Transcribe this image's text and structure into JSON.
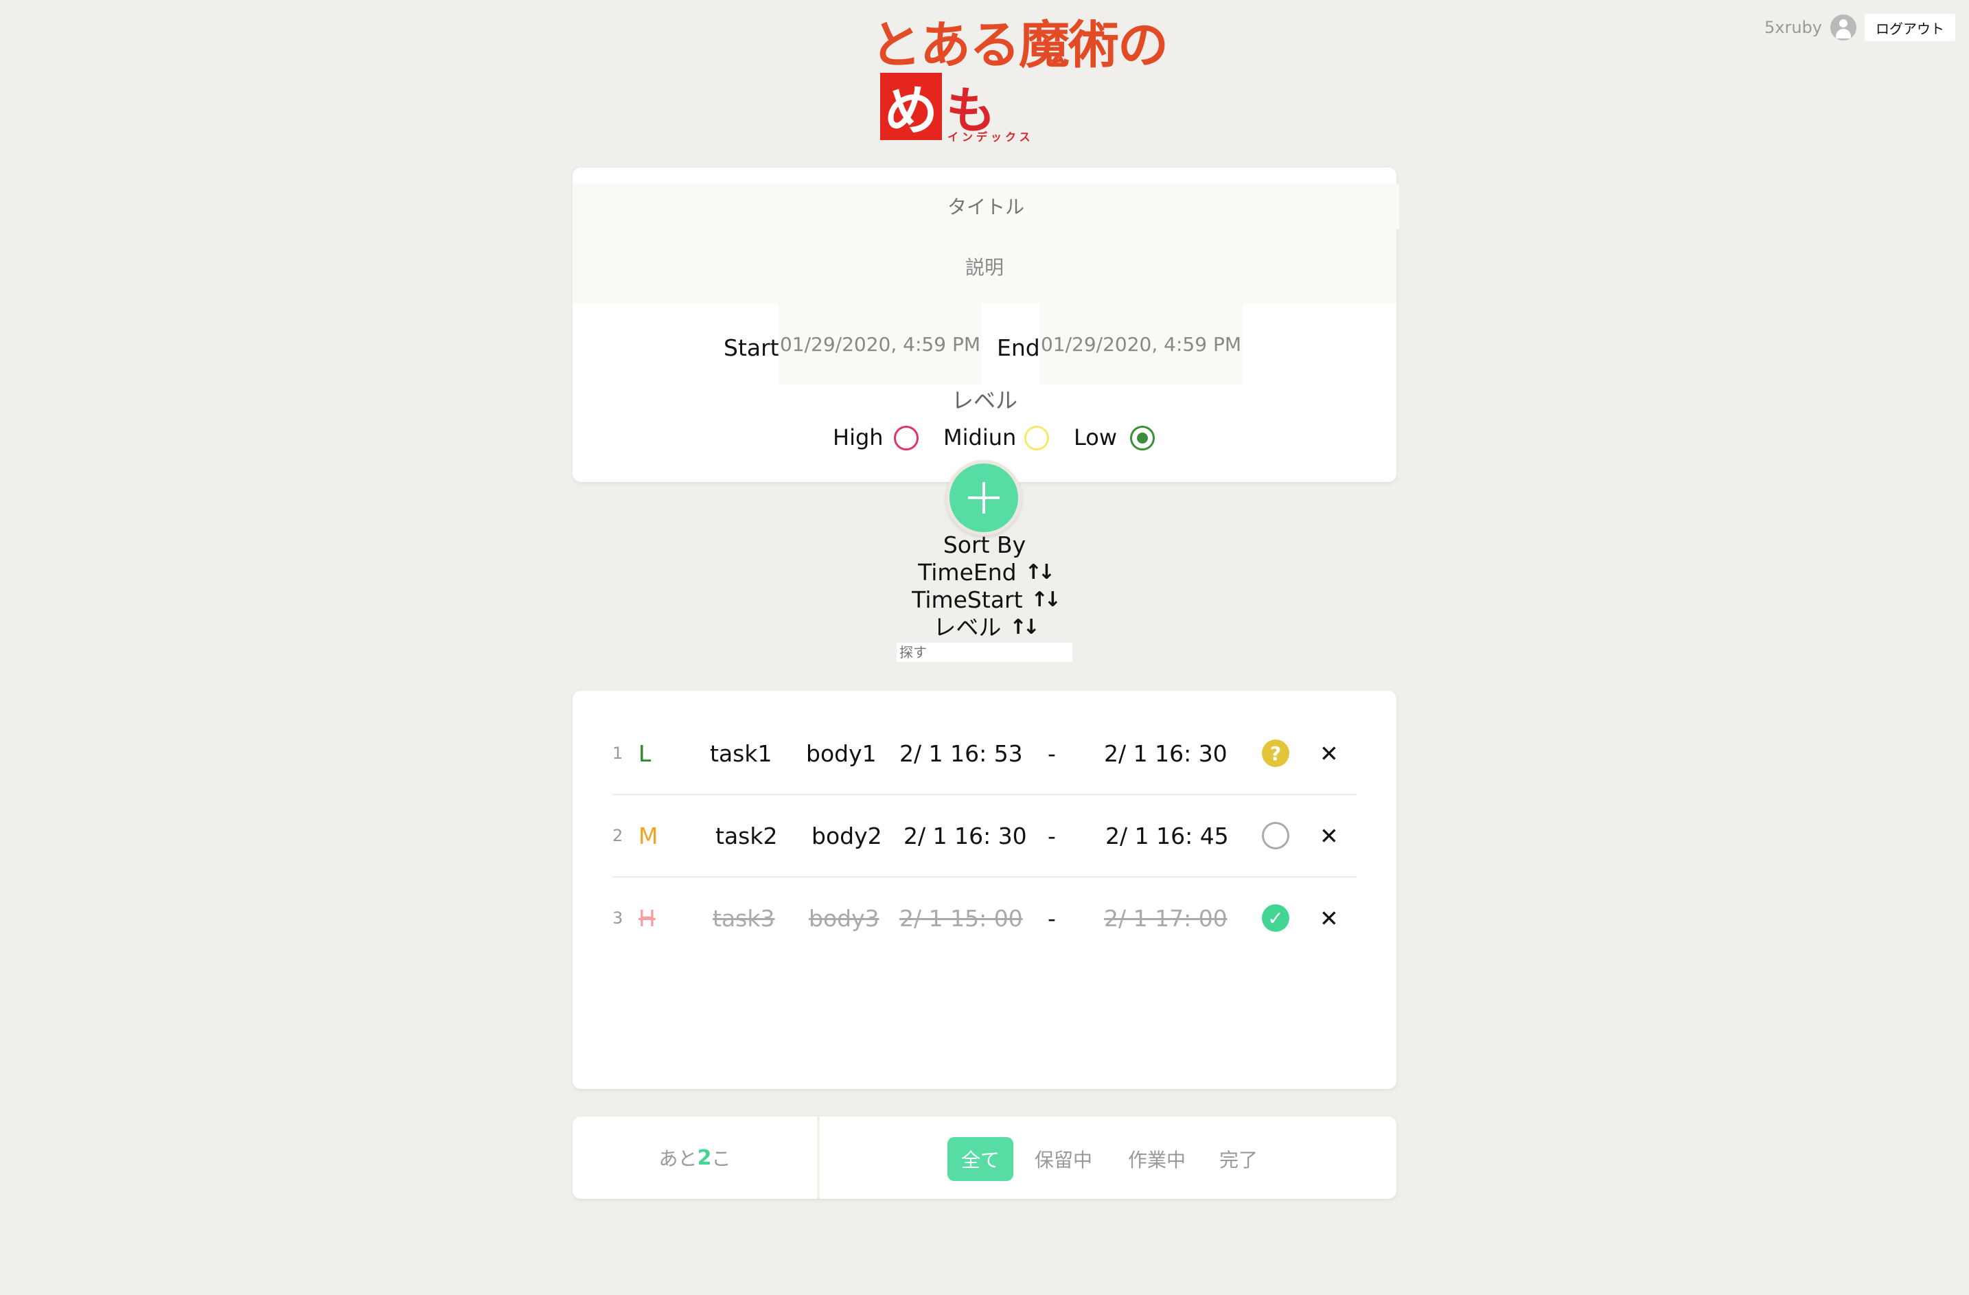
{
  "header": {
    "username": "5xruby",
    "logout_label": "ログアウト"
  },
  "logo": {
    "line1": "とある魔術の",
    "me": "め",
    "mo": "も",
    "sub": "インデックス"
  },
  "form": {
    "title_placeholder": "タイトル",
    "desc_placeholder": "説明",
    "start_label": "Start",
    "start_value": "01/29/2020, 4:59 PM",
    "end_label": "End",
    "end_value": "01/29/2020, 4:59 PM",
    "level_label": "レベル",
    "levels": [
      {
        "label": "High",
        "selected": false,
        "color": "#e0336b"
      },
      {
        "label": "Midiun",
        "selected": false,
        "color": "#f7e96a"
      },
      {
        "label": "Low",
        "selected": true,
        "color": "#3a8f3a"
      }
    ],
    "add_icon": "plus-icon"
  },
  "sort": {
    "title": "Sort By",
    "options": [
      {
        "label": "TimeEnd",
        "arrows": "↑↓"
      },
      {
        "label": "TimeStart",
        "arrows": "↑↓"
      },
      {
        "label": "レベル",
        "arrows": "↑↓"
      }
    ],
    "search_placeholder": "探す"
  },
  "tasks": [
    {
      "num": "1",
      "level": "L",
      "level_color": "#2a8a2a",
      "title": "task1",
      "body": "body1",
      "start": "2/ 1 16: 53",
      "dash": "-",
      "end": "2/ 1 16: 30",
      "status": "waiting",
      "status_icon": "question-icon",
      "status_glyph": "?",
      "done": false
    },
    {
      "num": "2",
      "level": "M",
      "level_color": "#f0a324",
      "title": "task2",
      "body": "body2",
      "start": "2/ 1 16: 30",
      "dash": "-",
      "end": "2/ 1 16: 45",
      "status": "in-progress",
      "status_icon": "circle-icon",
      "status_glyph": "",
      "done": false
    },
    {
      "num": "3",
      "level": "H",
      "level_color": "#f2a0a0",
      "title": "task3",
      "body": "body3",
      "start": "2/ 1 15: 00",
      "dash": "-",
      "end": "2/ 1 17: 00",
      "status": "done",
      "status_icon": "check-icon",
      "status_glyph": "✓",
      "done": true
    }
  ],
  "footer": {
    "remaining_prefix": "あと",
    "remaining_count": "2",
    "remaining_suffix": "こ",
    "filters": [
      "全て",
      "保留中",
      "作業中",
      "完了"
    ],
    "active_filter": "全て"
  },
  "colors": {
    "accent": "#57dca3",
    "background": "#f0efeb",
    "logo_red": "#e34a26"
  }
}
